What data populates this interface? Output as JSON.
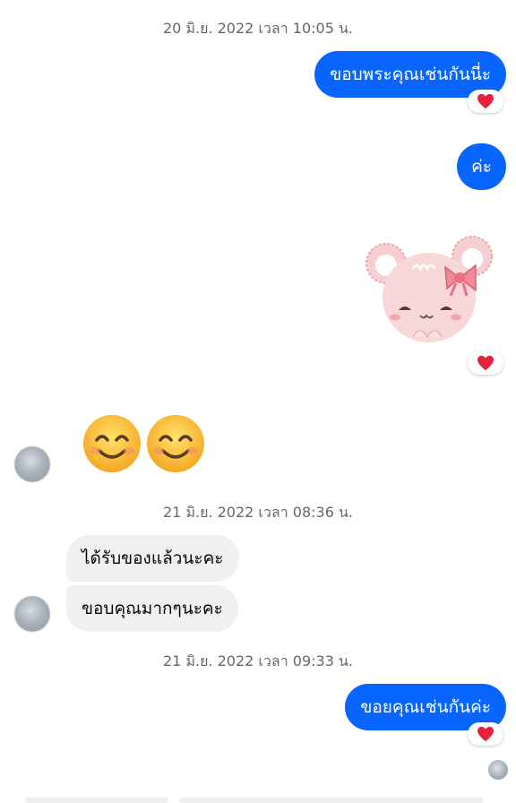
{
  "conversation": {
    "timestamps": [
      "20 มิ.ย. 2022 เวลา 10:05 น.",
      "21 มิ.ย. 2022 เวลา 08:36 น.",
      "21 มิ.ย. 2022 เวลา 09:33 น."
    ],
    "outgoing": [
      "ขอบพระคุณเช่นกันนี่ะ",
      "ค่ะ",
      "ขอยคุณเช่นกันค่ะ"
    ],
    "incoming": [
      "ได้รับของแล้วนะคะ",
      "ขอบคุณมากๆนะคะ"
    ],
    "reaction": "heart",
    "emoji_message": "smiling-face-with-smiling-eyes x2",
    "sticker": "pink-bear-with-bow"
  },
  "colors": {
    "outgoing_bubble": "#0866ff",
    "incoming_bubble": "#f0f0f0",
    "timestamp_text": "#65676b",
    "heart": "#e8203a"
  }
}
